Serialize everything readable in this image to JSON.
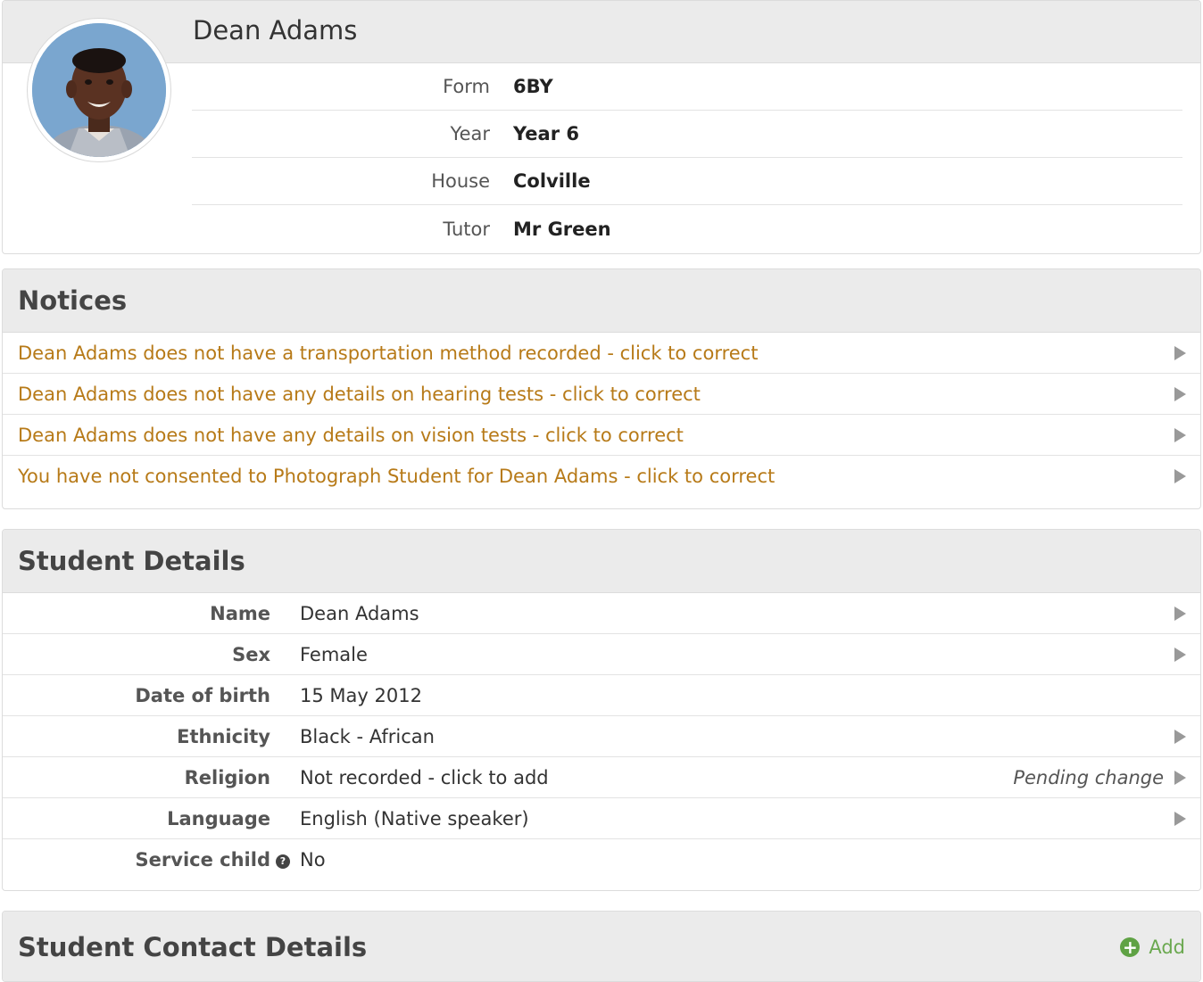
{
  "profile": {
    "name": "Dean Adams",
    "rows": [
      {
        "label": "Form",
        "value": "6BY"
      },
      {
        "label": "Year",
        "value": "Year 6"
      },
      {
        "label": "House",
        "value": "Colville"
      },
      {
        "label": "Tutor",
        "value": "Mr Green"
      }
    ]
  },
  "notices": {
    "title": "Notices",
    "items": [
      "Dean Adams does not have a transportation method recorded - click to correct",
      "Dean Adams does not have any details on hearing tests - click to correct",
      "Dean Adams does not have any details on vision tests - click to correct",
      "You have not consented to Photograph Student for Dean Adams - click to correct"
    ]
  },
  "student_details": {
    "title": "Student Details",
    "rows": [
      {
        "label": "Name",
        "value": "Dean Adams",
        "pending": ""
      },
      {
        "label": "Sex",
        "value": "Female",
        "pending": ""
      },
      {
        "label": "Date of birth",
        "value": "15 May 2012",
        "pending": ""
      },
      {
        "label": "Ethnicity",
        "value": "Black - African",
        "pending": ""
      },
      {
        "label": "Religion",
        "value": "Not recorded - click to add",
        "pending": "Pending change"
      },
      {
        "label": "Language",
        "value": "English (Native speaker)",
        "pending": ""
      },
      {
        "label": "Service child",
        "value": "No",
        "pending": ""
      }
    ]
  },
  "contact": {
    "title": "Student Contact Details",
    "add_label": "Add"
  },
  "colors": {
    "notice_text": "#b77a18",
    "add_green": "#5fa244",
    "header_bg": "#ebebeb"
  }
}
